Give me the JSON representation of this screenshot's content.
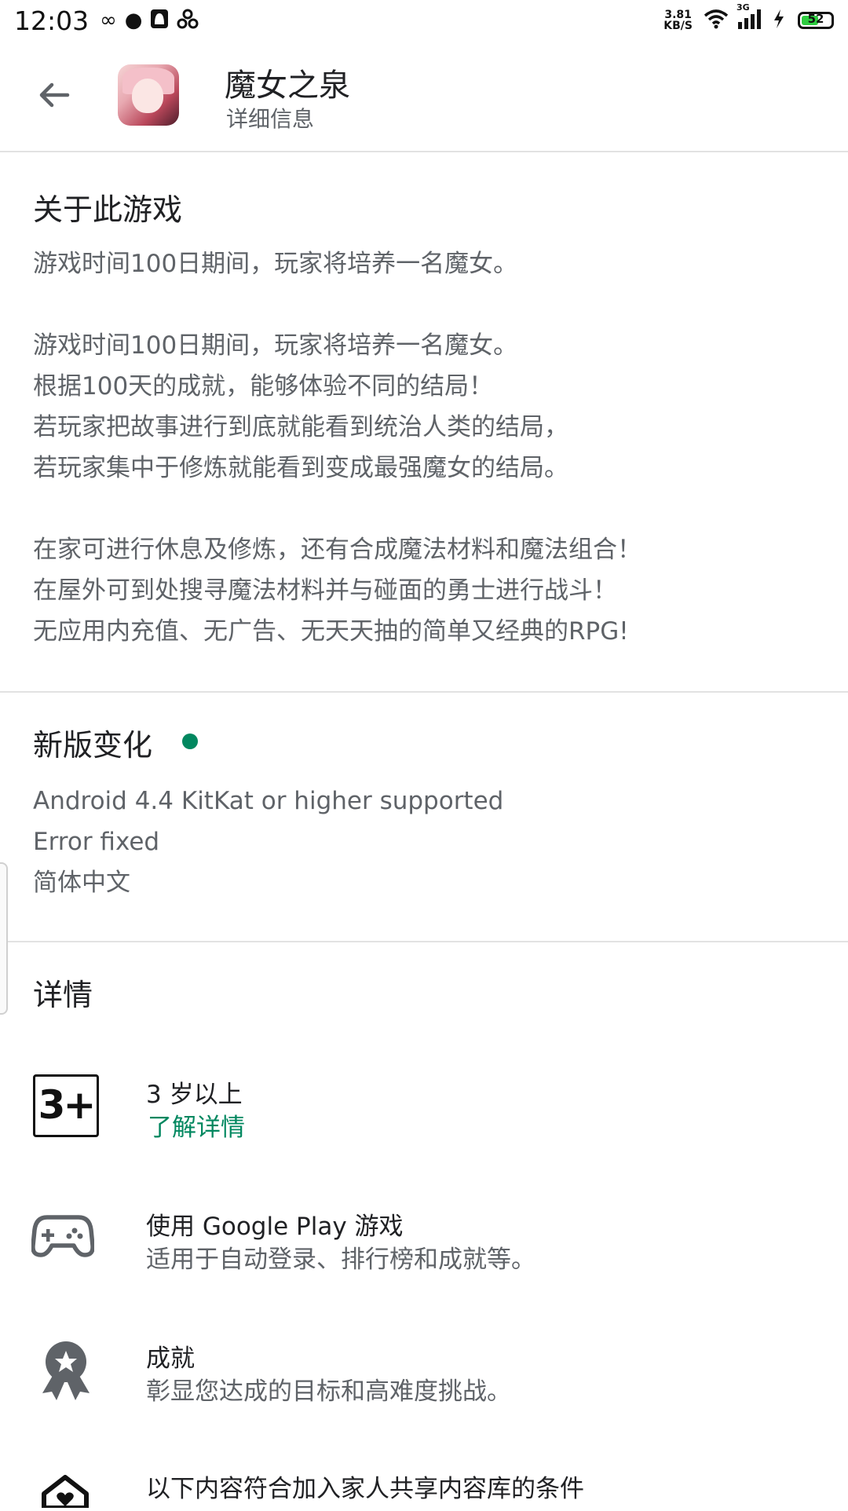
{
  "status_bar": {
    "time": "12:03",
    "net_speed_value": "3.81",
    "net_speed_unit": "KB/S",
    "network_type": "3G",
    "battery": "52"
  },
  "app_bar": {
    "title": "魔女之泉",
    "subtitle": "详细信息"
  },
  "about": {
    "title": "关于此游戏",
    "lines": [
      "游戏时间100日期间，玩家将培养一名魔女。",
      "",
      "游戏时间100日期间，玩家将培养一名魔女。",
      "根据100天的成就，能够体验不同的结局！",
      "若玩家把故事进行到底就能看到统治人类的结局，",
      "若玩家集中于修炼就能看到变成最强魔女的结局。",
      "",
      "在家可进行休息及修炼，还有合成魔法材料和魔法组合！",
      "在屋外可到处搜寻魔法材料并与碰面的勇士进行战斗！",
      "无应用内充值、无广告、无天天抽的简单又经典的RPG!"
    ]
  },
  "whats_new": {
    "title": "新版变化",
    "lines": [
      "Android 4.4 KitKat or higher supported",
      "Error fixed",
      "简体中文"
    ]
  },
  "details": {
    "title": "详情",
    "rating": {
      "badge": "3+",
      "label": "3 岁以上",
      "link": "了解详情"
    },
    "play_games": {
      "title": "使用 Google Play 游戏",
      "subtitle": "适用于自动登录、排行榜和成就等。"
    },
    "achievements": {
      "title": "成就",
      "subtitle": "彰显您达成的目标和高难度挑战。"
    },
    "family_library": {
      "title": "以下内容符合加入家人共享内容库的条件"
    }
  },
  "colors": {
    "accent_green": "#01875f",
    "text_primary": "#202124",
    "text_secondary": "#5f6368",
    "divider": "#e2e2e2"
  },
  "icons": [
    "back-arrow-icon",
    "game-controller-icon",
    "achievement-badge-icon",
    "family-house-icon",
    "wifi-icon",
    "signal-icon",
    "battery-icon"
  ]
}
